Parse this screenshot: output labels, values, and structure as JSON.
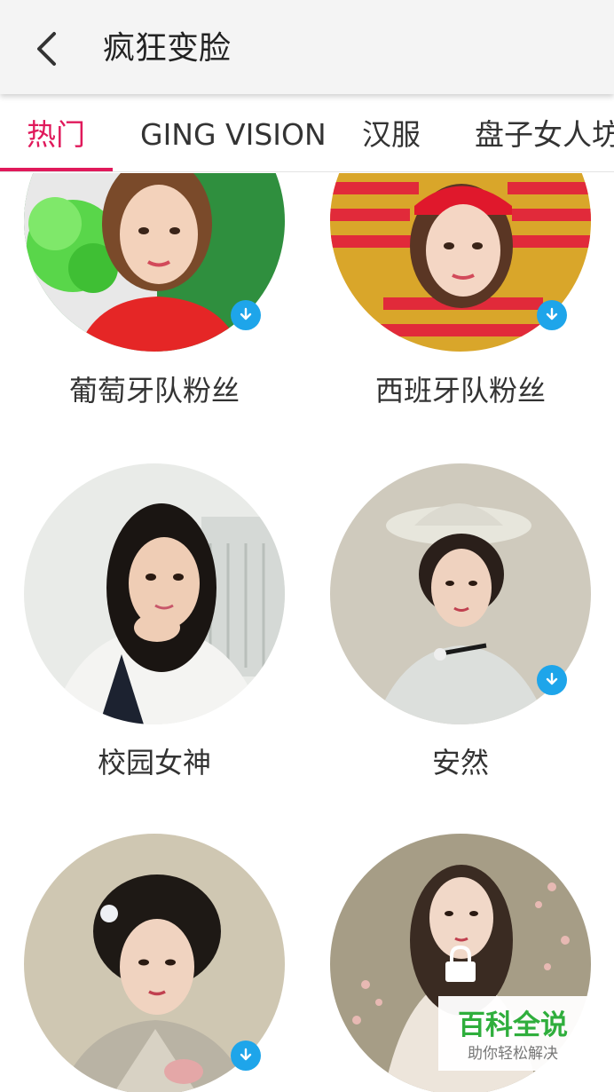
{
  "header": {
    "title": "疯狂变脸",
    "back_icon": "chevron-left-icon"
  },
  "tabs": [
    {
      "label": "热门",
      "active": true
    },
    {
      "label": "GING VISION",
      "active": false
    },
    {
      "label": "汉服",
      "active": false
    },
    {
      "label": "盘子女人坊",
      "active": false
    }
  ],
  "colors": {
    "accent": "#e0195b",
    "download_badge": "#1ea5ea",
    "watermark_green": "#2fae3c"
  },
  "items": [
    {
      "label": "葡萄牙队粉丝",
      "badge": "download-icon"
    },
    {
      "label": "西班牙队粉丝",
      "badge": "download-icon"
    },
    {
      "label": "校园女神",
      "badge": null
    },
    {
      "label": "安然",
      "badge": "download-icon"
    },
    {
      "label": "",
      "badge": "download-icon"
    },
    {
      "label": "",
      "badge": "lock-icon"
    }
  ],
  "watermark": {
    "title": "百科全说",
    "subtitle": "助你轻松解决"
  }
}
